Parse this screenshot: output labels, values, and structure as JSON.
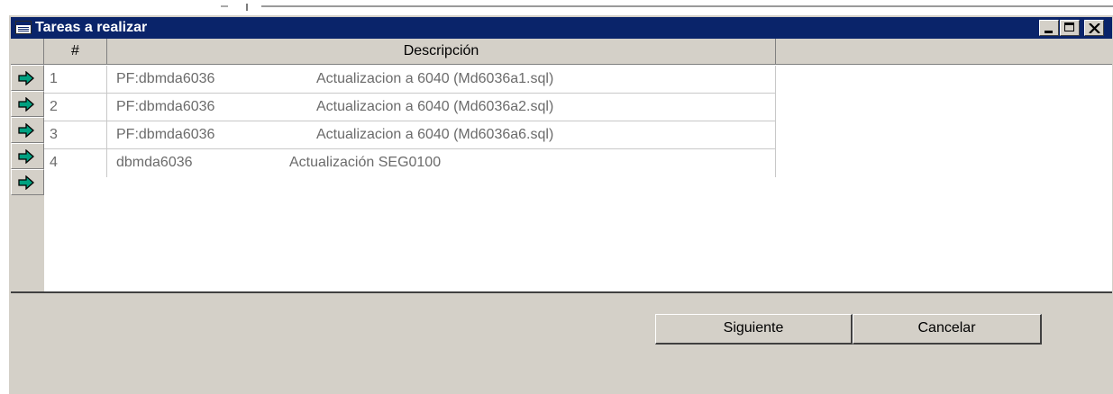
{
  "window": {
    "title": "Tareas a realizar",
    "controls": [
      "minimize-icon",
      "maximize-icon",
      "close-icon"
    ]
  },
  "grid": {
    "columns": [
      "#",
      "Descripción"
    ],
    "rows": [
      {
        "num": "1",
        "db": "PF:dbmda6036",
        "action": "Actualizacion a 6040 (Md6036a1.sql)"
      },
      {
        "num": "2",
        "db": "PF:dbmda6036",
        "action": "Actualizacion a 6040 (Md6036a2.sql)"
      },
      {
        "num": "3",
        "db": "PF:dbmda6036",
        "action": "Actualizacion a 6040 (Md6036a6.sql)"
      },
      {
        "num": "4",
        "db": "dbmda6036",
        "action": "Actualización SEG0100"
      }
    ],
    "row_indicator_icon": "arrow-right-icon"
  },
  "buttons": {
    "next": "Siguiente",
    "cancel": "Cancelar"
  },
  "colors": {
    "titlebar": "#0a246a",
    "face": "#d4d0c8",
    "arrow_fill": "#00a080",
    "cell_text": "#6b6b6b"
  }
}
